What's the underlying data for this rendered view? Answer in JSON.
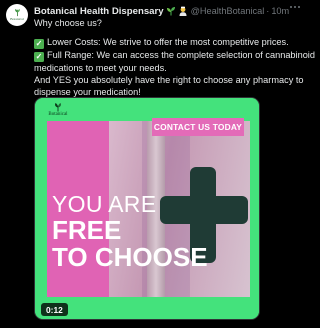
{
  "tweet": {
    "avatar_label": "Botanical",
    "author_name": "Botanical Health Dispensary",
    "author_emojis": [
      "seedling-emoji",
      "health-worker-emoji"
    ],
    "handle": "@HealthBotanical",
    "separator": "·",
    "time": "10m",
    "lines": [
      "Why choose us?",
      "Lower Costs: We strive to offer the most competitive prices.",
      "Full Range: We can access the complete selection of cannabinoid medications to meet your needs.",
      "And YES you absolutely have the right to choose any pharmacy to dispense your medication!"
    ]
  },
  "media": {
    "logo_text": "Botanical",
    "cta": "CONTACT US TODAY",
    "headline_1": "YOU ARE",
    "headline_2": "FREE",
    "headline_3": "TO CHOOSE",
    "duration": "0:12"
  },
  "colors": {
    "brand_green": "#44e27c",
    "brand_pink": "#e36bb8",
    "cross": "#1f3b35",
    "check_box": "#4caf50"
  }
}
